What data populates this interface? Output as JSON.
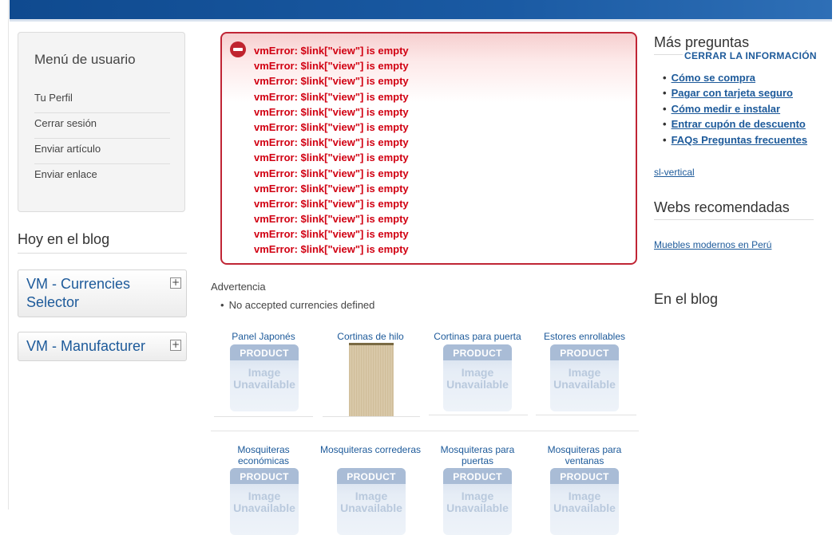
{
  "user_menu": {
    "title": "Menú de usuario",
    "items": [
      "Tu Perfil",
      "Cerrar sesión",
      "Enviar artículo",
      "Enviar enlace"
    ]
  },
  "blog_left": {
    "title": "Hoy en el blog"
  },
  "modules": [
    {
      "label": "VM - Currencies Selector",
      "toggle": "+"
    },
    {
      "label": "VM - Manufacturer",
      "toggle": "+"
    }
  ],
  "error": {
    "lines": [
      "vmError: $link[\"view\"] is empty",
      "vmError: $link[\"view\"] is empty",
      "vmError: $link[\"view\"] is empty",
      "vmError: $link[\"view\"] is empty",
      "vmError: $link[\"view\"] is empty",
      "vmError: $link[\"view\"] is empty",
      "vmError: $link[\"view\"] is empty",
      "vmError: $link[\"view\"] is empty",
      "vmError: $link[\"view\"] is empty",
      "vmError: $link[\"view\"] is empty",
      "vmError: $link[\"view\"] is empty",
      "vmError: $link[\"view\"] is empty",
      "vmError: $link[\"view\"] is empty",
      "vmError: $link[\"view\"] is empty"
    ]
  },
  "warning": {
    "title": "Advertencia",
    "item": "No accepted currencies defined"
  },
  "placeholder": {
    "top": "PRODUCT",
    "line1": "Image",
    "line2": "Unavailable"
  },
  "products_row1": [
    "Panel Japonés",
    "Cortinas de hilo",
    "Cortinas para puerta",
    "Estores enrollables"
  ],
  "products_row2": [
    "Mosquiteras económicas",
    "Mosquiteras correderas",
    "Mosquiteras para puertas",
    "Mosquiteras para ventanas"
  ],
  "right": {
    "faq_title": "Más preguntas",
    "close_info": "CERRAR LA INFORMACIÓN",
    "faq_links": [
      "Cómo se compra",
      "Pagar con tarjeta seguro",
      "Cómo medir e instalar",
      "Entrar cupón de descuento",
      "FAQs Preguntas frecuentes"
    ],
    "sl_link": "sl-vertical",
    "webs_title": "Webs recomendadas",
    "webs_link": "Muebles modernos en Perú",
    "blog_title": "En el blog"
  }
}
